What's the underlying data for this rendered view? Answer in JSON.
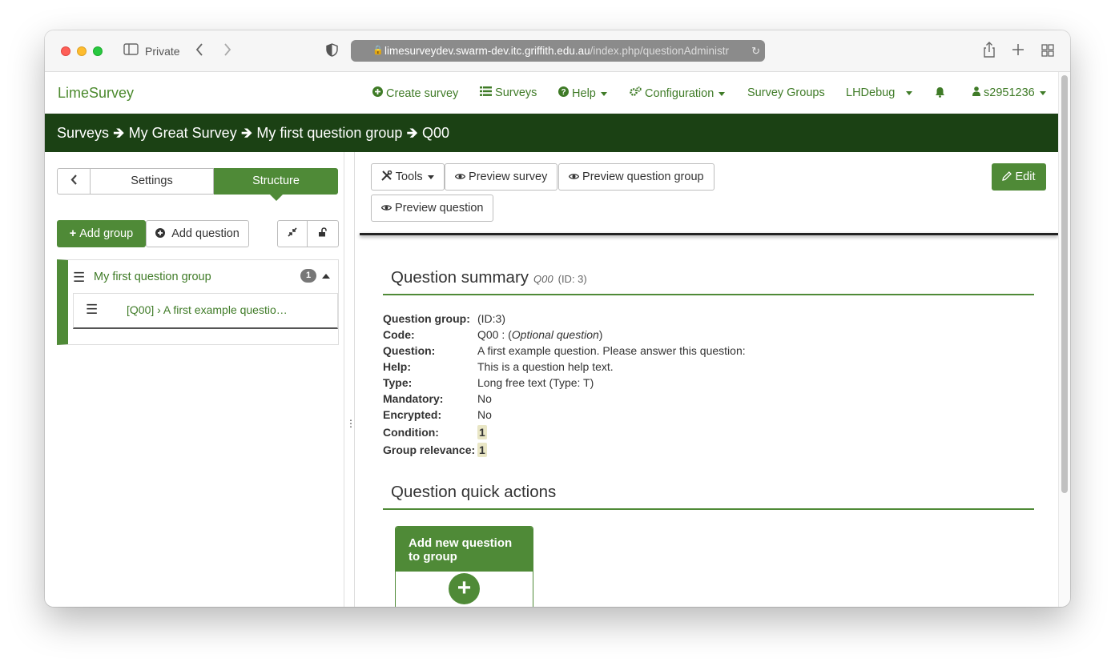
{
  "browser": {
    "private_label": "Private",
    "url_host": "limesurveydev.swarm-dev.itc.griffith.edu.au",
    "url_path": "/index.php/questionAdministr"
  },
  "nav": {
    "brand": "LimeSurvey",
    "create_survey": "Create survey",
    "surveys": "Surveys",
    "help": "Help",
    "configuration": "Configuration",
    "survey_groups": "Survey Groups",
    "lhdebug": "LHDebug",
    "user": "s2951236"
  },
  "breadcrumb": {
    "surveys": "Surveys",
    "survey": "My Great Survey",
    "group": "My first question group",
    "question": "Q00"
  },
  "sidebar": {
    "settings_tab": "Settings",
    "structure_tab": "Structure",
    "add_group": "Add group",
    "add_question": "Add question",
    "group_title": "My first question group",
    "group_count": "1",
    "question_item": "[Q00] › A first example questio…"
  },
  "toolbar": {
    "tools": "Tools",
    "preview_survey": "Preview survey",
    "preview_question_group": "Preview question group",
    "preview_question": "Preview question",
    "edit": "Edit"
  },
  "summary": {
    "title": "Question summary",
    "code": "Q00",
    "id": "(ID: 3)",
    "rows": [
      {
        "label": "Question group:",
        "value": "(ID:3)"
      },
      {
        "label": "Code:",
        "value": "Q00 : (",
        "italic": "Optional question",
        "value_after": ")"
      },
      {
        "label": "Question:",
        "value": "A first example question. Please answer this question:"
      },
      {
        "label": "Help:",
        "value": "This is a question help text."
      },
      {
        "label": "Type:",
        "value": "Long free text (Type: T)"
      },
      {
        "label": "Mandatory:",
        "value": "No"
      },
      {
        "label": "Encrypted:",
        "value": "No"
      },
      {
        "label": "Condition:",
        "value": "1"
      },
      {
        "label": "Group relevance:",
        "value": "1"
      }
    ]
  },
  "quick_actions": {
    "title": "Question quick actions",
    "card_title": "Add new question to group"
  },
  "colors": {
    "brand_green": "#4f8a37",
    "breadcrumb_bg": "#1b4114"
  },
  "icons": [
    "sidebar-icon",
    "back-icon",
    "forward-icon",
    "shield-icon",
    "lock-icon",
    "reload-icon",
    "share-icon",
    "plus-icon",
    "tabs-icon",
    "plus-circle-icon",
    "list-icon",
    "question-circle-icon",
    "gears-icon",
    "bell-icon",
    "user-icon",
    "arrow-right-icon",
    "chevron-left-icon",
    "compress-icon",
    "unlock-icon",
    "hamburger-icon",
    "tools-icon",
    "eye-icon",
    "pencil-icon"
  ]
}
